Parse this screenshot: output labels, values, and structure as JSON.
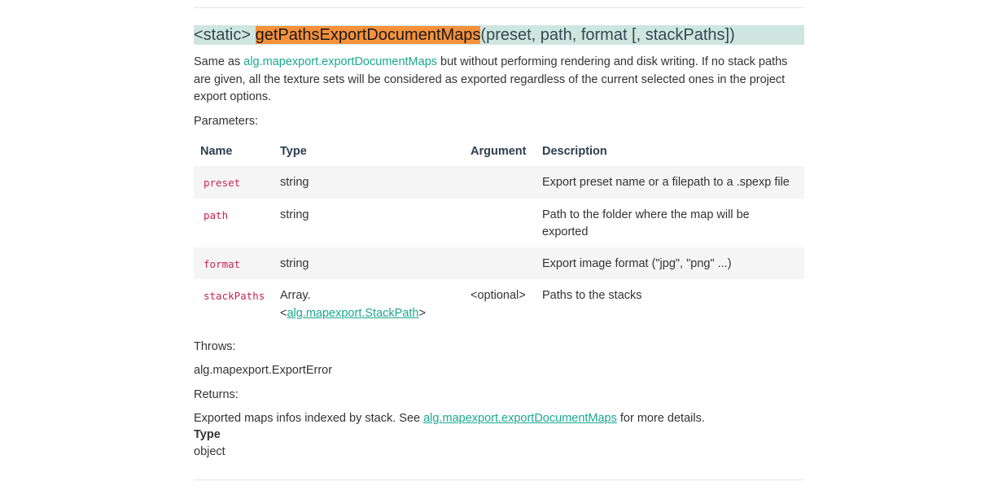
{
  "signature": {
    "prefix": "<static> ",
    "function_name": "getPathsExportDocumentMaps",
    "args": "(preset, path, format [, stackPaths])"
  },
  "description": {
    "before_link": "Same as ",
    "link": "alg.mapexport.exportDocumentMaps",
    "after_link": " but without performing rendering and disk writing. If no stack paths are given, all the texture sets will be considered as exported regardless of the current selected ones in the project export options."
  },
  "parameters_label": "Parameters:",
  "table": {
    "headers": {
      "name": "Name",
      "type": "Type",
      "argument": "Argument",
      "description": "Description"
    },
    "rows": [
      {
        "name": "preset",
        "type": "string",
        "argument": "",
        "description": "Export preset name or a filepath to a .spexp file"
      },
      {
        "name": "path",
        "type": "string",
        "argument": "",
        "description": "Path to the folder where the map will be exported"
      },
      {
        "name": "format",
        "type": "string",
        "argument": "",
        "description": "Export image format (\"jpg\", \"png\" ...)"
      },
      {
        "name": "stackPaths",
        "type_prefix": "Array.",
        "type_open": "<",
        "type_link": "alg.mapexport.StackPath",
        "type_close": ">",
        "argument": "<optional>",
        "description": "Paths to the stacks"
      }
    ]
  },
  "throws_label": "Throws:",
  "throws_link": "alg.mapexport.ExportError",
  "returns_label": "Returns:",
  "returns": {
    "before_link": "Exported maps infos indexed by stack. See ",
    "link": "alg.mapexport.exportDocumentMaps",
    "after_link": " for more details.",
    "type_label": "Type",
    "type_value": "object"
  }
}
